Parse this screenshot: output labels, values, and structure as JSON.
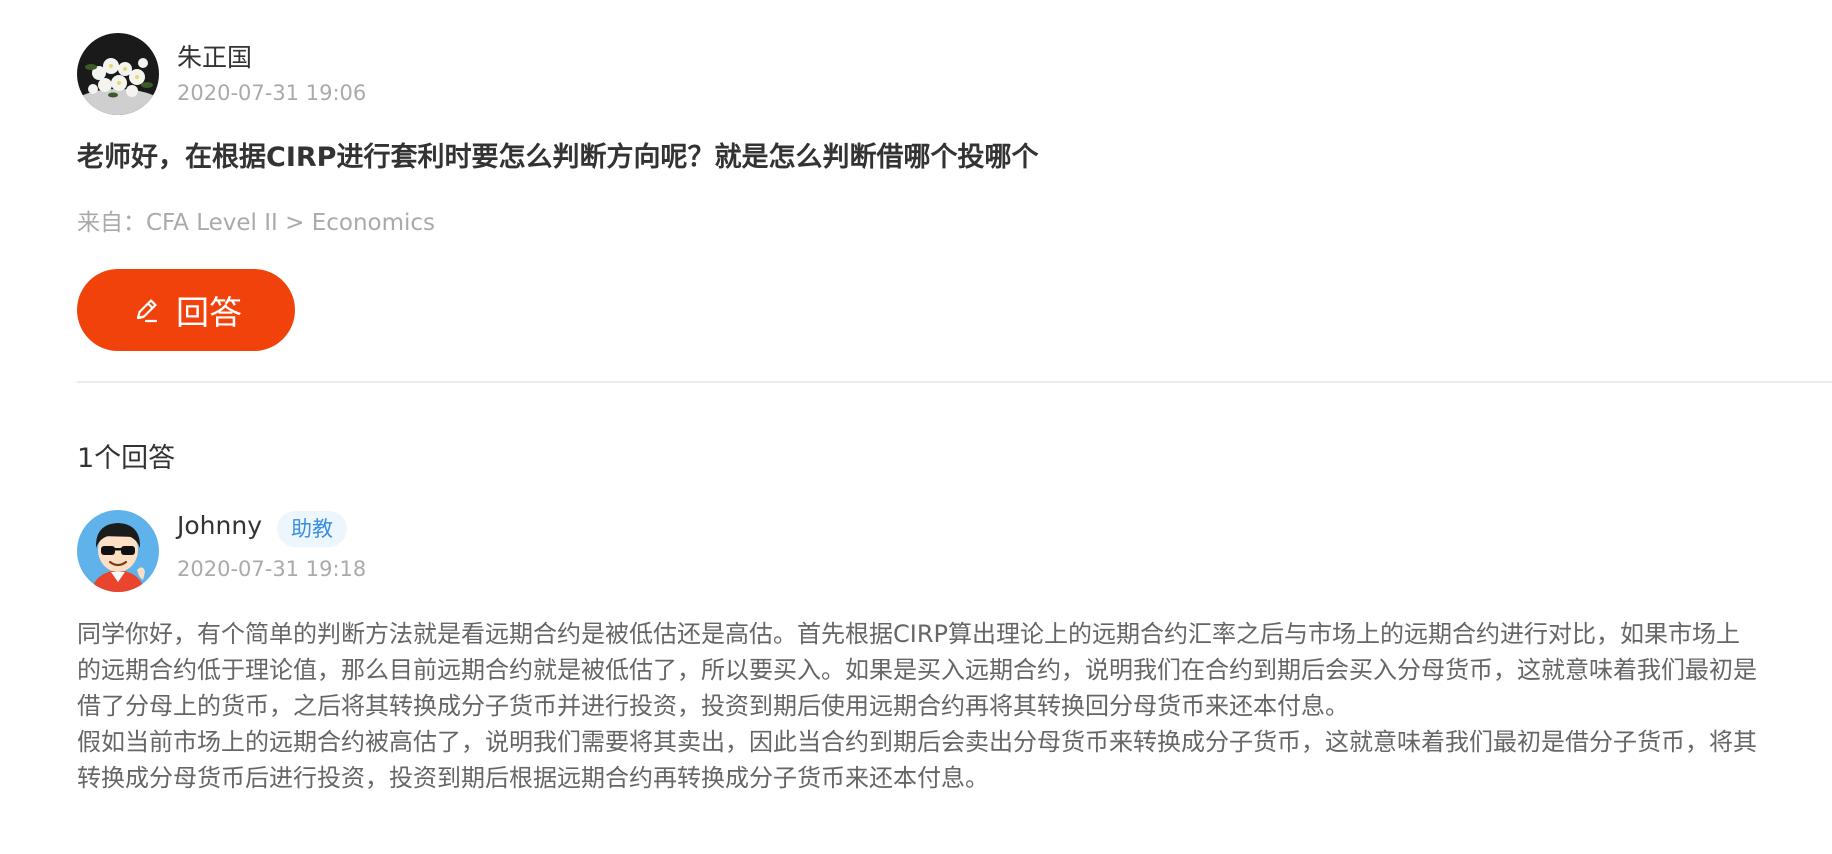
{
  "question": {
    "author_name": "朱正国",
    "time": "2020-07-31 19:06",
    "title": "老师好，在根据CIRP进行套利时要怎么判断方向呢？就是怎么判断借哪个投哪个",
    "source": "来自：CFA Level II > Economics"
  },
  "answer_button": {
    "label": "回答",
    "icon": "pencil-icon",
    "color": "#f2420c"
  },
  "answers_section": {
    "count_label": "1个回答"
  },
  "answer": {
    "author_name": "Johnny",
    "role_badge": "助教",
    "time": "2020-07-31 19:18",
    "paragraphs": [
      "同学你好，有个简单的判断方法就是看远期合约是被低估还是高估。首先根据CIRP算出理论上的远期合约汇率之后与市场上的远期合约进行对比，如果市场上的远期合约低于理论值，那么目前远期合约就是被低估了，所以要买入。如果是买入远期合约，说明我们在合约到期后会买入分母货币，这就意味着我们最初是借了分母上的货币，之后将其转换成分子货币并进行投资，投资到期后使用远期合约再将其转换回分母货币来还本付息。",
      "假如当前市场上的远期合约被高估了，说明我们需要将其卖出，因此当合约到期后会卖出分母货币来转换成分子货币，这就意味着我们最初是借分子货币，将其转换成分母货币后进行投资，投资到期后根据远期合约再转换成分子货币来还本付息。"
    ]
  },
  "colors": {
    "accent": "#f2420c",
    "badge_text": "#3b8fe0",
    "muted_text": "#aaaaaa",
    "body_text": "#666666"
  }
}
